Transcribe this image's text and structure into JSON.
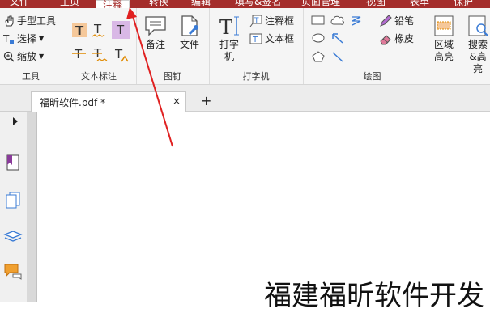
{
  "menubar": {
    "tabs": [
      {
        "label": "文件"
      },
      {
        "label": "主页"
      },
      {
        "label": "注释",
        "active": true
      },
      {
        "label": "转换"
      },
      {
        "label": "编辑"
      },
      {
        "label": "填写&签名"
      },
      {
        "label": "页面管理"
      },
      {
        "label": "视图"
      },
      {
        "label": "表单"
      },
      {
        "label": "保护"
      }
    ]
  },
  "ribbon": {
    "tools": {
      "hand": "手型工具",
      "select": "选择",
      "zoom": "缩放",
      "group": "工具"
    },
    "text_markup": {
      "group": "文本标注"
    },
    "pin": {
      "note": "备注",
      "file": "文件",
      "group": "图钉"
    },
    "typewriter": {
      "typewriter": "打字机",
      "callout": "注释框",
      "textbox": "文本框",
      "group": "打字机"
    },
    "drawing": {
      "pencil": "铅笔",
      "eraser": "橡皮",
      "area_highlight": "区域高亮",
      "search_highlight": "搜索&高亮",
      "group": "绘图"
    }
  },
  "document": {
    "tab_title": "福昕软件.pdf *",
    "close": "×",
    "new_tab": "+",
    "body_text": "福建福昕软件开发"
  },
  "colors": {
    "accent": "#a42d2b",
    "arrow": "#e02020",
    "highlight": "#d9b8e6"
  }
}
